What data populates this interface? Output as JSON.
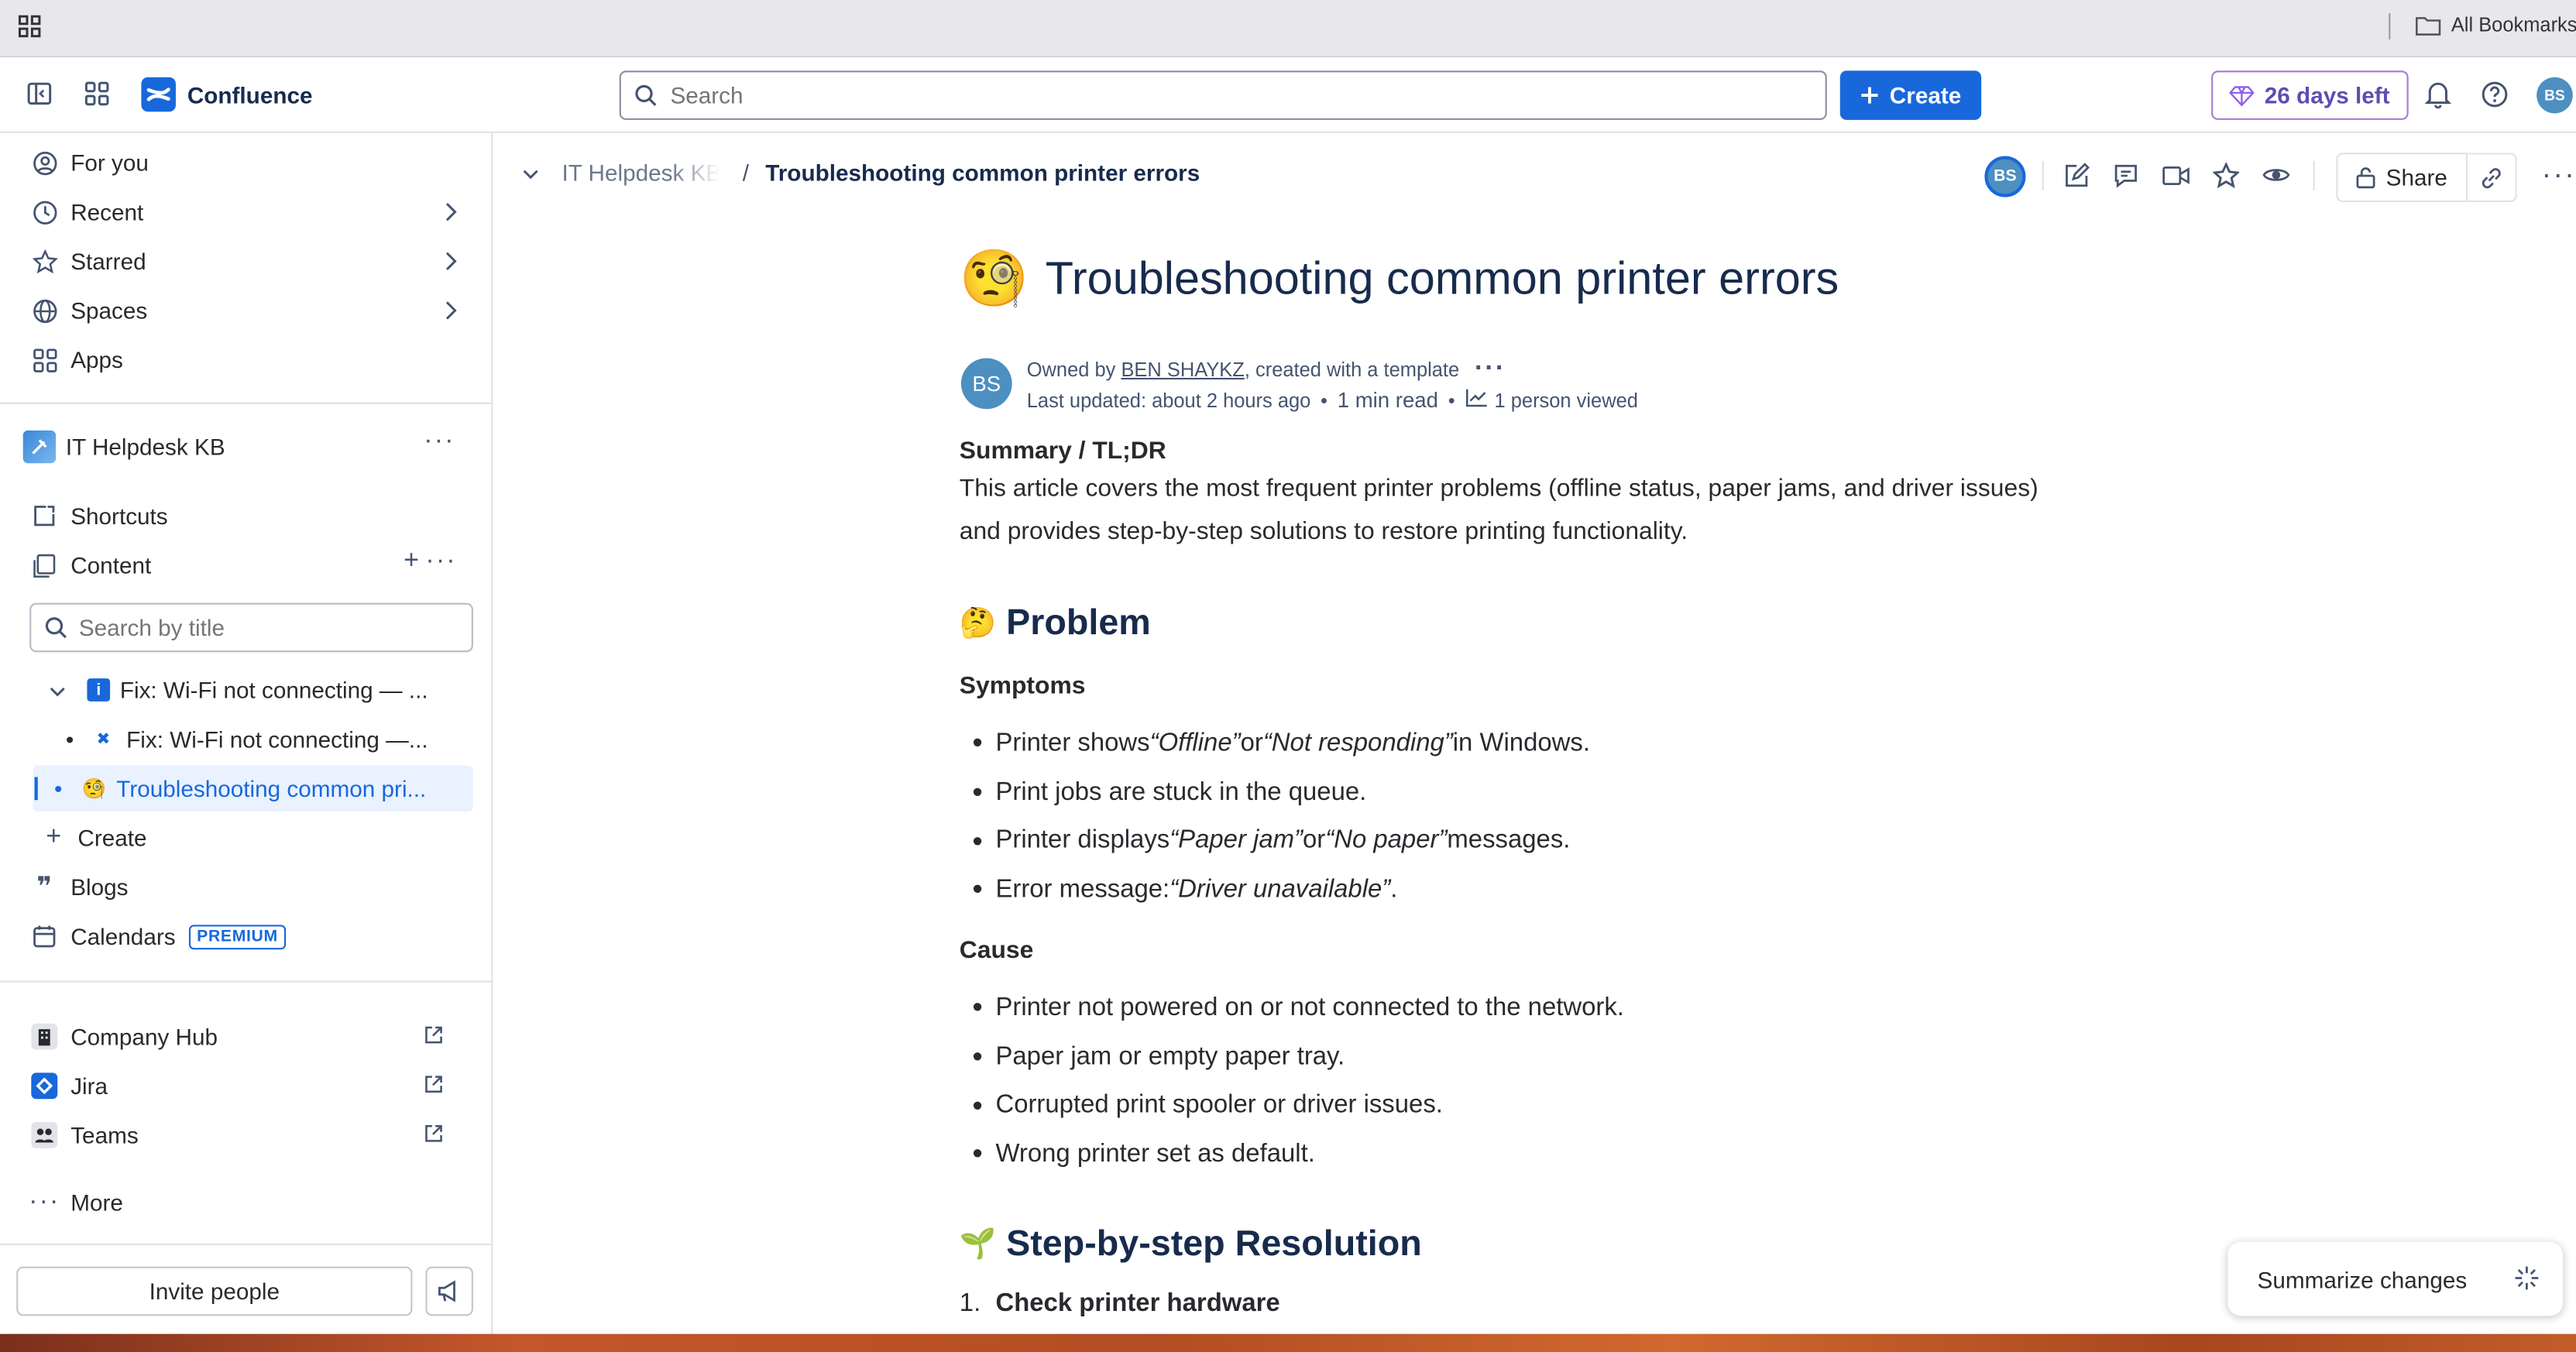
{
  "browser": {
    "bookmarks_label": "All Bookmarks"
  },
  "topnav": {
    "product_name": "Confluence",
    "search_placeholder": "Search",
    "create_label": "Create",
    "trial_label": "26 days left",
    "avatar_initials": "BS",
    "colors": {
      "brand": "#1868db",
      "trial_border": "#a17dd6",
      "trial_text": "#5e4db2"
    }
  },
  "sidebar": {
    "nav": [
      {
        "label": "For you",
        "icon": "user-circle-icon"
      },
      {
        "label": "Recent",
        "icon": "clock-icon"
      },
      {
        "label": "Starred",
        "icon": "star-icon"
      },
      {
        "label": "Spaces",
        "icon": "globe-icon"
      },
      {
        "label": "Apps",
        "icon": "apps-grid-icon"
      }
    ],
    "space_name": "IT Helpdesk KB",
    "shortcuts_label": "Shortcuts",
    "content_label": "Content",
    "search_placeholder": "Search by title",
    "tree": [
      {
        "label": "Fix: Wi-Fi not connecting — ..."
      },
      {
        "label": "Fix: Wi-Fi not connecting —..."
      },
      {
        "label": "Troubleshooting common pri..."
      }
    ],
    "create_label": "Create",
    "blogs_label": "Blogs",
    "calendars_label": "Calendars",
    "premium_badge": "PREMIUM",
    "apps": [
      {
        "label": "Company Hub"
      },
      {
        "label": "Jira"
      },
      {
        "label": "Teams"
      }
    ],
    "more_label": "More",
    "invite_label": "Invite people"
  },
  "page": {
    "breadcrumb_space": "IT Helpdesk KB",
    "breadcrumb_separator": "/",
    "breadcrumb_current": "Troubleshooting common printer errors",
    "share_label": "Share",
    "avatar_initials": "BS",
    "title": "Troubleshooting common printer errors",
    "owned_by_prefix": "Owned by ",
    "owner": "BEN SHAYKZ",
    "owned_by_suffix": ", created with a template",
    "last_updated": "Last updated: about 2 hours ago",
    "read_time": "1 min read",
    "viewed": "1 person viewed",
    "summary_heading": "Summary / TL;DR",
    "summary_line1": "This article covers the most frequent printer problems (offline status, paper jams, and driver issues)",
    "summary_line2": "and provides step-by-step solutions to restore printing functionality.",
    "problem_heading": "Problem",
    "symptoms_heading": "Symptoms",
    "symptoms": [
      {
        "pre": "Printer shows ",
        "em1": "“Offline”",
        "mid": " or ",
        "em2": "“Not responding”",
        "post": " in Windows."
      },
      {
        "pre": "Print jobs are stuck in the queue.",
        "em1": "",
        "mid": "",
        "em2": "",
        "post": ""
      },
      {
        "pre": "Printer displays ",
        "em1": "“Paper jam”",
        "mid": " or ",
        "em2": "“No paper”",
        "post": " messages."
      },
      {
        "pre": "Error message: ",
        "em1": "“Driver unavailable”",
        "mid": "",
        "em2": "",
        "post": "."
      }
    ],
    "cause_heading": "Cause",
    "causes": [
      "Printer not powered on or not connected to the network.",
      "Paper jam or empty paper tray.",
      "Corrupted print spooler or driver issues.",
      "Wrong printer set as default."
    ],
    "resolution_heading": "Step-by-step Resolution",
    "step1_number": "1.",
    "step1": "Check printer hardware"
  },
  "summarize_label": "Summarize changes"
}
